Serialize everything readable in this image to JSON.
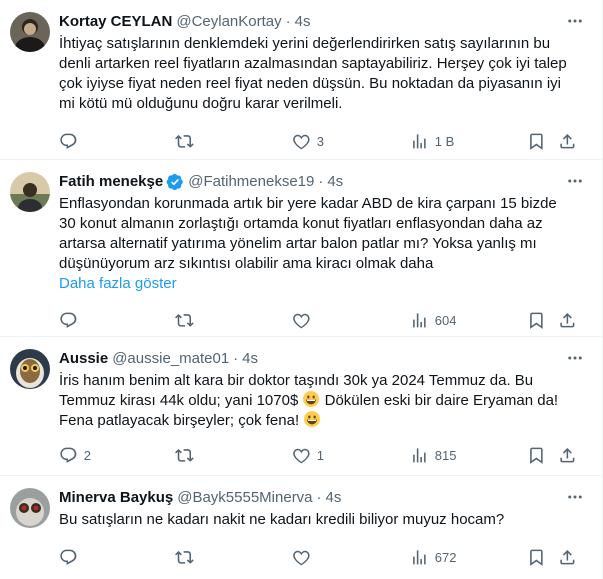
{
  "feed": {
    "tweets": [
      {
        "name": "Kortay CEYLAN",
        "handle": "@CeylanKortay",
        "time": "4s",
        "verified": false,
        "text": "İhtiyaç satışlarının denklemdeki yerini değerlendirirken satış sayılarının bu denli artarken reel fiyatların azalmasından saptayabiliriz. Herşey çok iyi talep çok iyiyse fiyat neden reel fiyat neden düşsün. Bu noktadan da piyasanın iyi mi kötü mü olduğunu doğru karar verilmeli.",
        "show_more": "",
        "replies": "",
        "retweets": "",
        "likes": "3",
        "views": "1 B"
      },
      {
        "name": "Fatih menekşe",
        "handle": "@Fatihmenekse19",
        "time": "4s",
        "verified": true,
        "text": "Enflasyondan korunmada artık bir yere kadar ABD de kira çarpanı 15 bizde 30 konut almanın zorlaştığı ortamda konut fiyatları enflasyondan daha az artarsa alternatif yatırıma yönelim artar balon patlar mı? Yoksa yanlış mı düşünüyorum arz sıkıntısı olabilir ama kiracı olmak daha",
        "show_more": "Daha fazla göster",
        "replies": "",
        "retweets": "",
        "likes": "",
        "views": "604"
      },
      {
        "name": "Aussie",
        "handle": "@aussie_mate01",
        "time": "4s",
        "verified": false,
        "text_parts": [
          "İris hanım benim alt kara bir doktor taşındı 30k ya  2024 Temmuz da. Bu Temmuz kirası 44k oldu; yani 1070$ ",
          " Dökülen eski bir daire Eryaman da! Fena patlayacak birşeyler; çok fena! "
        ],
        "emoji": "grinning-face",
        "show_more": "",
        "replies": "2",
        "retweets": "",
        "likes": "1",
        "views": "815"
      },
      {
        "name": "Minerva Baykuş",
        "handle": "@Bayk5555Minerva",
        "time": "4s",
        "verified": false,
        "text": "Bu satışların ne kadarı nakit ne kadarı kredili biliyor muyuz hocam?",
        "show_more": "",
        "replies": "",
        "retweets": "",
        "likes": "",
        "views": "672"
      }
    ]
  },
  "colors": {
    "text": "#0f1419",
    "secondary": "#536471",
    "link": "#1d9bf0",
    "divider": "#eff3f4"
  },
  "icons": {
    "reply": "reply-icon",
    "retweet": "retweet-icon",
    "like": "heart-icon",
    "views": "views-icon",
    "bookmark": "bookmark-icon",
    "share": "share-icon",
    "more": "more-dots-icon",
    "verified": "verified-badge-icon"
  }
}
